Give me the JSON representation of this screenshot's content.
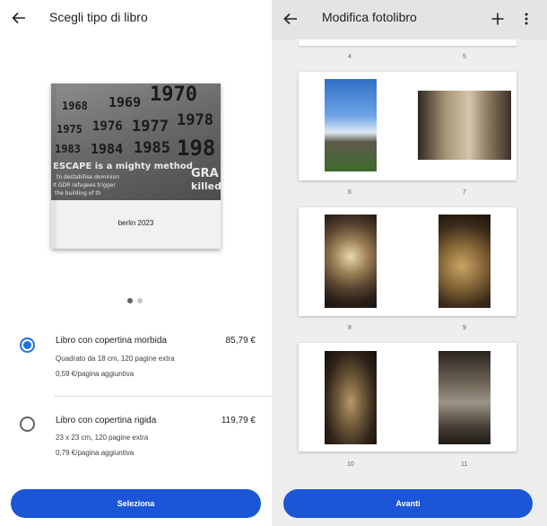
{
  "left_screen": {
    "title": "Scegli tipo di libro",
    "cover": {
      "title": "berlin 2023",
      "wall_years": [
        "1968",
        "1969",
        "1970",
        "1975",
        "1976",
        "1977",
        "1978",
        "1983",
        "1984",
        "1985",
        "198"
      ],
      "wall_text": [
        "ESCAPE is a mighty method",
        "to destabilise dominion",
        "It GDR refugees trigger",
        "the building of th",
        "GRA",
        "killed"
      ]
    },
    "carousel": {
      "active_index": 0,
      "count": 2
    },
    "options": [
      {
        "name": "Libro con copertina morbida",
        "price": "85,79 €",
        "detail": "Quadrato da 18 cm, 120 pagine extra",
        "extra_page": "0,59 €/pagina aggiuntiva",
        "selected": true
      },
      {
        "name": "Libro con copertina rigida",
        "price": "119,79 €",
        "detail": "23 x 23 cm, 120 pagine extra",
        "extra_page": "0,79 €/pagina aggiuntiva",
        "selected": false
      }
    ],
    "primary_button": "Seleziona"
  },
  "right_screen": {
    "title": "Modifica fotolibro",
    "page_numbers_top": [
      "4",
      "5"
    ],
    "spreads": [
      {
        "left_page": "6",
        "right_page": "7"
      },
      {
        "left_page": "8",
        "right_page": "9"
      },
      {
        "left_page": "10",
        "right_page": "11"
      }
    ],
    "primary_button": "Avanti"
  },
  "colors": {
    "accent": "#1a73e8",
    "button": "#1a56d6",
    "right_background": "#eeeeee",
    "right_topbar": "#e4e4e4"
  },
  "icons": {
    "back": "arrow-left-icon",
    "add": "plus-icon",
    "more": "more-vertical-icon"
  }
}
